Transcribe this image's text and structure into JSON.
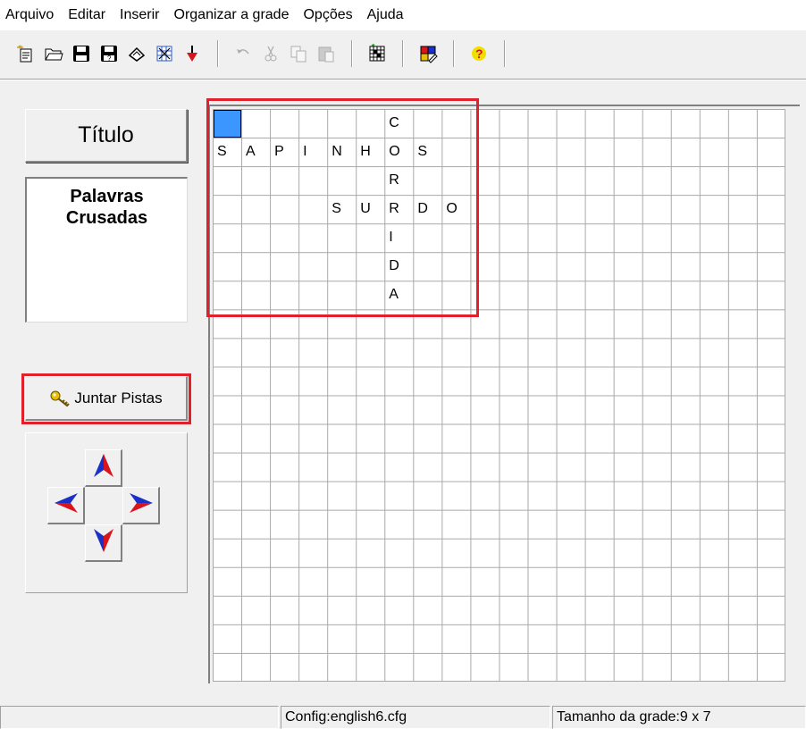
{
  "menu": [
    "Arquivo",
    "Editar",
    "Inserir",
    "Organizar a grade",
    "Opções",
    "Ajuda"
  ],
  "toolbar": {
    "groups": [
      [
        "new-icon",
        "open-folder-icon",
        "save-icon",
        "save-as-icon",
        "erase-icon",
        "web-export-icon",
        "red-arrow-icon"
      ],
      [
        "undo-icon",
        "cut-icon",
        "copy-icon",
        "paste-icon"
      ],
      [
        "grid-fill-icon"
      ],
      [
        "colors-icon"
      ],
      [
        "help-icon"
      ]
    ]
  },
  "left_panel": {
    "title_button": "Título",
    "title_text_line1": "Palavras",
    "title_text_line2": "Crusadas",
    "join_clues_button": "Juntar Pistas",
    "arrows": [
      "arrow-up-icon",
      "arrow-left-icon",
      "arrow-right-icon",
      "arrow-down-icon"
    ]
  },
  "grid": {
    "columns": 20,
    "rows": 20,
    "cursor": {
      "row": 0,
      "col": 0
    },
    "letters": [
      {
        "r": 0,
        "c": 6,
        "ch": "C"
      },
      {
        "r": 1,
        "c": 0,
        "ch": "S"
      },
      {
        "r": 1,
        "c": 1,
        "ch": "A"
      },
      {
        "r": 1,
        "c": 2,
        "ch": "P"
      },
      {
        "r": 1,
        "c": 3,
        "ch": "I"
      },
      {
        "r": 1,
        "c": 4,
        "ch": "N"
      },
      {
        "r": 1,
        "c": 5,
        "ch": "H"
      },
      {
        "r": 1,
        "c": 6,
        "ch": "O"
      },
      {
        "r": 1,
        "c": 7,
        "ch": "S"
      },
      {
        "r": 2,
        "c": 6,
        "ch": "R"
      },
      {
        "r": 3,
        "c": 4,
        "ch": "S"
      },
      {
        "r": 3,
        "c": 5,
        "ch": "U"
      },
      {
        "r": 3,
        "c": 6,
        "ch": "R"
      },
      {
        "r": 3,
        "c": 7,
        "ch": "D"
      },
      {
        "r": 3,
        "c": 8,
        "ch": "O"
      },
      {
        "r": 4,
        "c": 6,
        "ch": "I"
      },
      {
        "r": 5,
        "c": 6,
        "ch": "D"
      },
      {
        "r": 6,
        "c": 6,
        "ch": "A"
      }
    ]
  },
  "status": {
    "config": "Config:english6.cfg",
    "grid_size": "Tamanho da grade:9 x 7"
  },
  "colors": {
    "highlight": "#e0202a",
    "cursor": "#3c96ff"
  }
}
